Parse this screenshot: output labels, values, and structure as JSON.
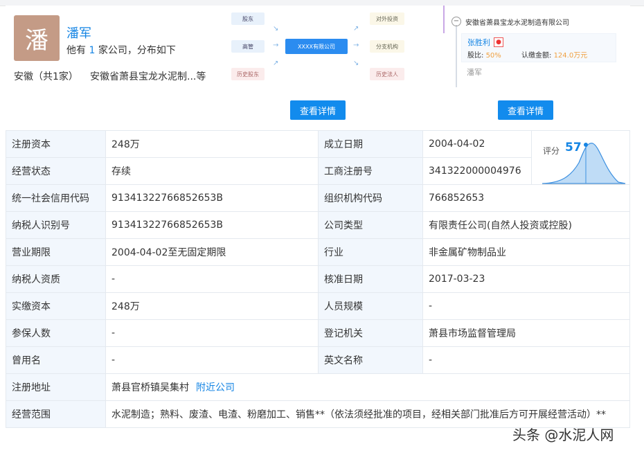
{
  "person": {
    "avatar_char": "潘",
    "name": "潘军",
    "desc_prefix": "他有 ",
    "desc_count": "1",
    "desc_suffix": " 家公司，分布如下",
    "region": "安徽（共1家）",
    "company_short": "安徽省萧县宝龙水泥制...等"
  },
  "structure_card": {
    "left_boxes": [
      "股东",
      "高管",
      "历史股东"
    ],
    "center_box": "XXXX有限公司",
    "right_boxes": [
      "对外投资",
      "分支机构",
      "历史法人"
    ],
    "button": "查看详情"
  },
  "equity_card": {
    "company": "安徽省萧县宝龙水泥制造有限公司",
    "shareholder_name": "张胜利",
    "ratio_label": "股比:",
    "ratio_value": "50%",
    "amount_label": "认缴金额:",
    "amount_value": "124.0万元",
    "second_shareholder": "潘军",
    "button": "查看详情"
  },
  "score": {
    "label": "评分",
    "value": "57"
  },
  "info_rows": [
    {
      "l1": "注册资本",
      "v1": "248万",
      "l2": "成立日期",
      "v2": "2004-04-02"
    },
    {
      "l1": "经营状态",
      "v1": "存续",
      "l2": "工商注册号",
      "v2": "341322000004976"
    },
    {
      "l1": "统一社会信用代码",
      "v1": "91341322766852653B",
      "l2": "组织机构代码",
      "v2": "766852653"
    },
    {
      "l1": "纳税人识别号",
      "v1": "91341322766852653B",
      "l2": "公司类型",
      "v2": "有限责任公司(自然人投资或控股)"
    },
    {
      "l1": "营业期限",
      "v1": "2004-04-02至无固定期限",
      "l2": "行业",
      "v2": "非金属矿物制品业"
    },
    {
      "l1": "纳税人资质",
      "v1": "-",
      "l2": "核准日期",
      "v2": "2017-03-23"
    },
    {
      "l1": "实缴资本",
      "v1": "248万",
      "l2": "人员规模",
      "v2": "-"
    },
    {
      "l1": "参保人数",
      "v1": "-",
      "l2": "登记机关",
      "v2": "萧县市场监督管理局"
    },
    {
      "l1": "曾用名",
      "v1": "-",
      "l2": "英文名称",
      "v2": "-"
    }
  ],
  "address": {
    "label": "注册地址",
    "value": "萧县官桥镇吴集村",
    "link": "附近公司"
  },
  "scope": {
    "label": "经营范围",
    "value": "水泥制造；熟料、废渣、电渣、粉磨加工、销售**（依法须经批准的项目，经相关部门批准后方可开展经营活动）**"
  },
  "watermark": "头条 @水泥人网",
  "colors": {
    "accent": "#1585e4",
    "button": "#128bed",
    "label_bg": "#f2f7fd"
  }
}
